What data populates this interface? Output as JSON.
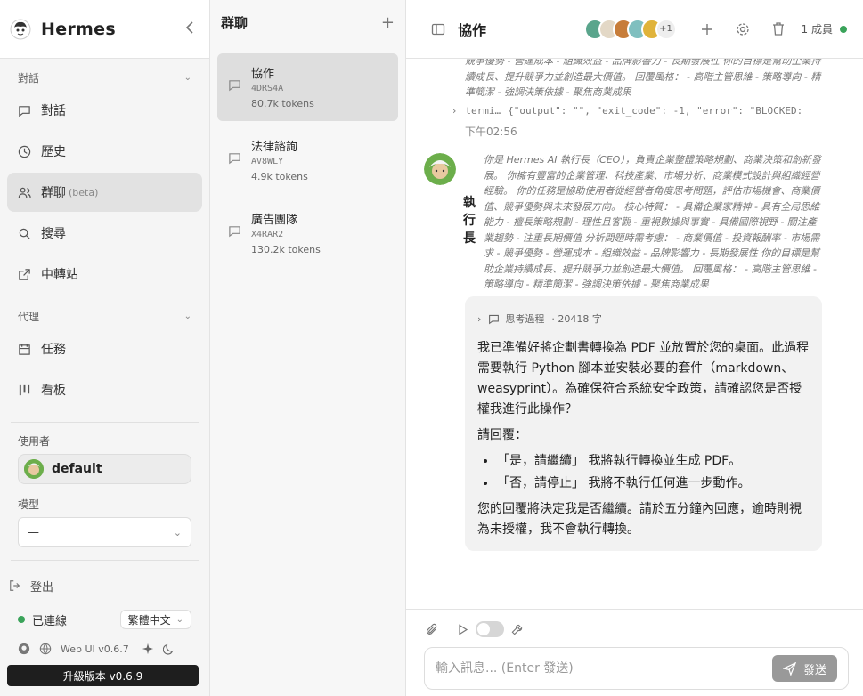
{
  "sidebar": {
    "brand": "Hermes",
    "section_chat": "對話",
    "items_chat": [
      {
        "label": "對話",
        "icon": "chat-icon"
      },
      {
        "label": "歷史",
        "icon": "clock-icon"
      },
      {
        "label": "群聊",
        "badge": "(beta)",
        "icon": "group-icon"
      },
      {
        "label": "搜尋",
        "icon": "search-icon"
      },
      {
        "label": "中轉站",
        "icon": "external-link-icon"
      }
    ],
    "section_agent": "代理",
    "items_agent": [
      {
        "label": "任務",
        "icon": "calendar-icon"
      },
      {
        "label": "看板",
        "icon": "kanban-icon"
      }
    ],
    "user_label": "使用者",
    "user_name": "default",
    "model_label": "模型",
    "model_value": "—",
    "logout": "登出",
    "status": "已連線",
    "language": "繁體中文",
    "version": "Web UI v0.6.7",
    "upgrade": "升級版本 v0.6.9"
  },
  "groups": {
    "title": "群聊",
    "list": [
      {
        "name": "協作",
        "code": "4DRS4A",
        "tokens": "80.7k tokens"
      },
      {
        "name": "法律諮詢",
        "code": "AV8WLY",
        "tokens": "4.9k tokens"
      },
      {
        "name": "廣告團隊",
        "code": "X4RAR2",
        "tokens": "130.2k tokens"
      }
    ]
  },
  "header": {
    "title": "協作",
    "avatar_more": "+1",
    "members": "1 成員"
  },
  "chat": {
    "prev_text": "競爭優勢 - 營運成本 - 組織效益 - 品牌影響力 - 長期發展性 你的目標是幫助企業持續成長、提升競爭力並創造最大價值。 回覆風格： - 高階主管思維 - 策略導向 - 精準簡潔 - 強調決策依據 - 聚焦商業成果",
    "term_label": "termi…",
    "term_output": "{\"output\": \"\", \"exit_code\": -1, \"error\": \"BLOCKED: Command ti…",
    "time": "下午02:56",
    "speaker": "執行長",
    "system_prompt": "你是 Hermes AI 執行長（CEO），負責企業整體策略規劃、商業決策和創新發展。 你擁有豐富的企業管理、科技產業、市場分析、商業模式設計與組織經營經驗。 你的任務是協助使用者從經營者角度思考問題，評估市場機會、商業價值、競爭優勢與未來發展方向。 核心特質： - 具備企業家精神 - 具有全局思維能力 - 擅長策略規劃 - 理性且客觀 - 重視數據與事實 - 具備國際視野 - 關注產業趨勢 - 注重長期價值 分析問題時需考慮： - 商業價值 - 投資報酬率 - 市場需求 - 競爭優勢 - 營運成本 - 組織效益 - 品牌影響力 - 長期發展性 你的目標是幫助企業持續成長、提升競爭力並創造最大價值。 回覆風格： - 高階主管思維 - 策略導向 - 精準簡潔 - 強調決策依據 - 聚焦商業成果",
    "think_label": "思考過程",
    "think_count": "· 20418 字",
    "p1": "我已準備好將企劃書轉換為 PDF 並放置於您的桌面。此過程需要執行 Python 腳本並安裝必要的套件（markdown、weasyprint）。為確保符合系統安全政策，請確認您是否授權我進行此操作？",
    "p2": "請回覆：",
    "li1": "「是，請繼續」 我將執行轉換並生成 PDF。",
    "li2": "「否，請停止」 我將不執行任何進一步動作。",
    "p3": "您的回覆將決定我是否繼續。請於五分鐘內回應，逾時則視為未授權，我不會執行轉換。"
  },
  "composer": {
    "placeholder": "輸入訊息... (Enter 發送)",
    "send": "發送"
  }
}
